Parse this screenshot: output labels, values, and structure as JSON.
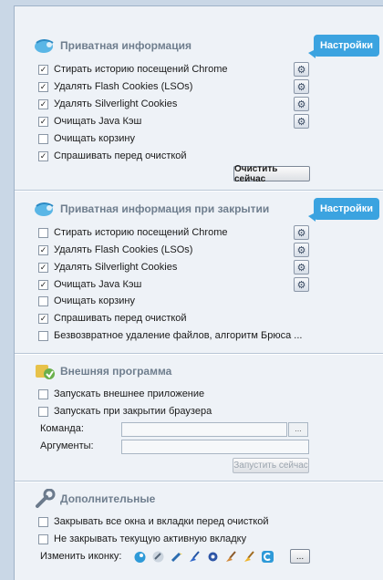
{
  "private": {
    "title": "Приватная информация",
    "tooltip": "Настройки",
    "items": [
      {
        "label": "Стирать историю посещений Chrome",
        "checked": "✓"
      },
      {
        "label": "Удалять Flash Cookies (LSOs)",
        "checked": "✓"
      },
      {
        "label": "Удалять Silverlight Cookies",
        "checked": "✓"
      },
      {
        "label": "Очищать Java Кэш",
        "checked": "✓"
      },
      {
        "label": "Очищать корзину",
        "checked": ""
      },
      {
        "label": "Спрашивать перед очисткой",
        "checked": "✓"
      }
    ],
    "clear_button": "Очистить сейчас"
  },
  "private_close": {
    "title": "Приватная информация при закрытии",
    "tooltip": "Настройки",
    "items": [
      {
        "label": "Стирать историю посещений Chrome",
        "checked": ""
      },
      {
        "label": "Удалять Flash Cookies (LSOs)",
        "checked": "✓"
      },
      {
        "label": "Удалять Silverlight Cookies",
        "checked": "✓"
      },
      {
        "label": "Очищать Java Кэш",
        "checked": "✓"
      },
      {
        "label": "Очищать корзину",
        "checked": ""
      },
      {
        "label": "Спрашивать перед очисткой",
        "checked": "✓"
      },
      {
        "label": "Безвозвратное удаление файлов, алгоритм Брюса ...",
        "checked": ""
      }
    ]
  },
  "external": {
    "title": "Внешняя программа",
    "items": [
      {
        "label": "Запускать внешнее приложение",
        "checked": ""
      },
      {
        "label": "Запускать при закрытии браузера",
        "checked": ""
      }
    ],
    "command_label": "Команда:",
    "args_label": "Аргументы:",
    "browse_label": "...",
    "run_button": "Запустить сейчас"
  },
  "additional": {
    "title": "Дополнительные",
    "items": [
      {
        "label": "Закрывать все окна и вкладки перед очисткой",
        "checked": ""
      },
      {
        "label": "Не закрывать текущую активную вкладку",
        "checked": ""
      }
    ],
    "change_icon_label": "Изменить иконку:",
    "more_button": "..."
  }
}
